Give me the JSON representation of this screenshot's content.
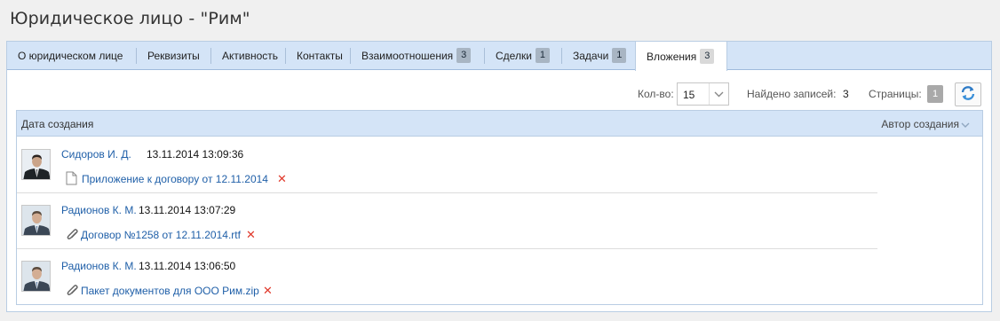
{
  "page_title": "Юридическое лицо - \"Рим\"",
  "tabs": [
    {
      "label": "О юридическом лице",
      "count": ""
    },
    {
      "label": "Реквизиты",
      "count": ""
    },
    {
      "label": "Активность",
      "count": ""
    },
    {
      "label": "Контакты",
      "count": ""
    },
    {
      "label": "Взаимоотношения",
      "count": "3"
    },
    {
      "label": "Сделки",
      "count": "1"
    },
    {
      "label": "Задачи",
      "count": "1"
    },
    {
      "label": "Вложения",
      "count": "3"
    }
  ],
  "active_tab": "Вложения",
  "toolbar": {
    "qty_label": "Кол-во:",
    "qty_value": "15",
    "found_label": "Найдено записей:",
    "found_value": "3",
    "pages_label": "Страницы:",
    "page_current": "1"
  },
  "grid": {
    "col_left": "Дата создания",
    "col_right": "Автор создания"
  },
  "attachments": [
    {
      "author": "Сидоров И. Д.",
      "datetime": "13.11.2014 13:09:36",
      "file": "Приложение к договору от 12.11.2014",
      "file_icon": "document-icon"
    },
    {
      "author": "Радионов К. М.",
      "datetime": "13.11.2014 13:07:29",
      "file": "Договор №1258 от 12.11.2014.rtf",
      "file_icon": "paperclip-icon"
    },
    {
      "author": "Радионов К. М.",
      "datetime": "13.11.2014 13:06:50",
      "file": "Пакет документов для ООО Рим.zip",
      "file_icon": "paperclip-icon"
    }
  ],
  "delete_glyph": "✕"
}
